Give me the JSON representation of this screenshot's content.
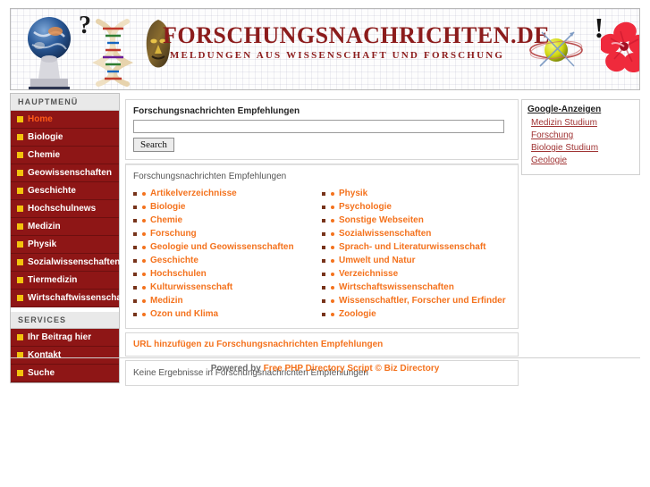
{
  "header": {
    "title": "FORSCHUNGSNACHRICHTEN.DE",
    "subtitle": "MELDUNGEN AUS WISSENSCHAFT UND FORSCHUNG",
    "decorations": [
      "globe-statue-icon",
      "question-mark-icon",
      "dna-helix-icon",
      "african-mask-icon",
      "atom-orbit-icon",
      "exclamation-mark-icon",
      "hibiscus-flower-icon"
    ],
    "title_color": "#8c1c1c"
  },
  "sidebar": {
    "main_heading": "HAUPTMENÜ",
    "main_items": [
      {
        "label": "Home",
        "active": true
      },
      {
        "label": "Biologie",
        "active": false
      },
      {
        "label": "Chemie",
        "active": false
      },
      {
        "label": "Geowissenschaften",
        "active": false
      },
      {
        "label": "Geschichte",
        "active": false
      },
      {
        "label": "Hochschulnews",
        "active": false
      },
      {
        "label": "Medizin",
        "active": false
      },
      {
        "label": "Physik",
        "active": false
      },
      {
        "label": "Sozialwissenschaften",
        "active": false
      },
      {
        "label": "Tiermedizin",
        "active": false
      },
      {
        "label": "Wirtschaftwissenschaft",
        "active": false
      }
    ],
    "services_heading": "SERVICES",
    "services_items": [
      {
        "label": "Ihr Beitrag hier",
        "active": false
      },
      {
        "label": "Kontakt",
        "active": false
      },
      {
        "label": "Suche",
        "active": false
      }
    ],
    "bg_color": "#8e1616",
    "bullet_color": "#f2c30d",
    "active_color": "#ff5a18"
  },
  "main": {
    "panel_title": "Forschungsnachrichten Empfehlungen",
    "search": {
      "value": "",
      "placeholder": "",
      "button_label": "Search"
    },
    "subheading": "Forschungsnachrichten Empfehlungen",
    "categories_left": [
      "Artikelverzeichnisse",
      "Biologie",
      "Chemie",
      "Forschung",
      "Geologie und Geowissenschaften",
      "Geschichte",
      "Hochschulen",
      "Kulturwissenschaft",
      "Medizin",
      "Ozon und Klima"
    ],
    "categories_right": [
      "Physik",
      "Psychologie",
      "Sonstige Webseiten",
      "Sozialwissenschaften",
      "Sprach- und Literaturwissenschaft",
      "Umwelt und Natur",
      "Verzeichnisse",
      "Wirtschaftswissenschaften",
      "Wissenschaftler, Forscher und Erfinder",
      "Zoologie"
    ],
    "add_url_label": "URL hinzufügen zu Forschungsnachrichten Empfehlungen",
    "no_results": "Keine Ergebnisse in Forschungsnachrichten Empfehlungen",
    "link_color": "#f4721d"
  },
  "ads": {
    "title": "Google-Anzeigen",
    "links": [
      "Medizin Studium",
      "Forschung",
      "Biologie Studium",
      "Geologie"
    ],
    "link_color": "#a03434"
  },
  "footer": {
    "prefix": "Powered by ",
    "link1": "Free PHP Directory Script",
    "separator": " © ",
    "link2": "Biz Directory"
  }
}
